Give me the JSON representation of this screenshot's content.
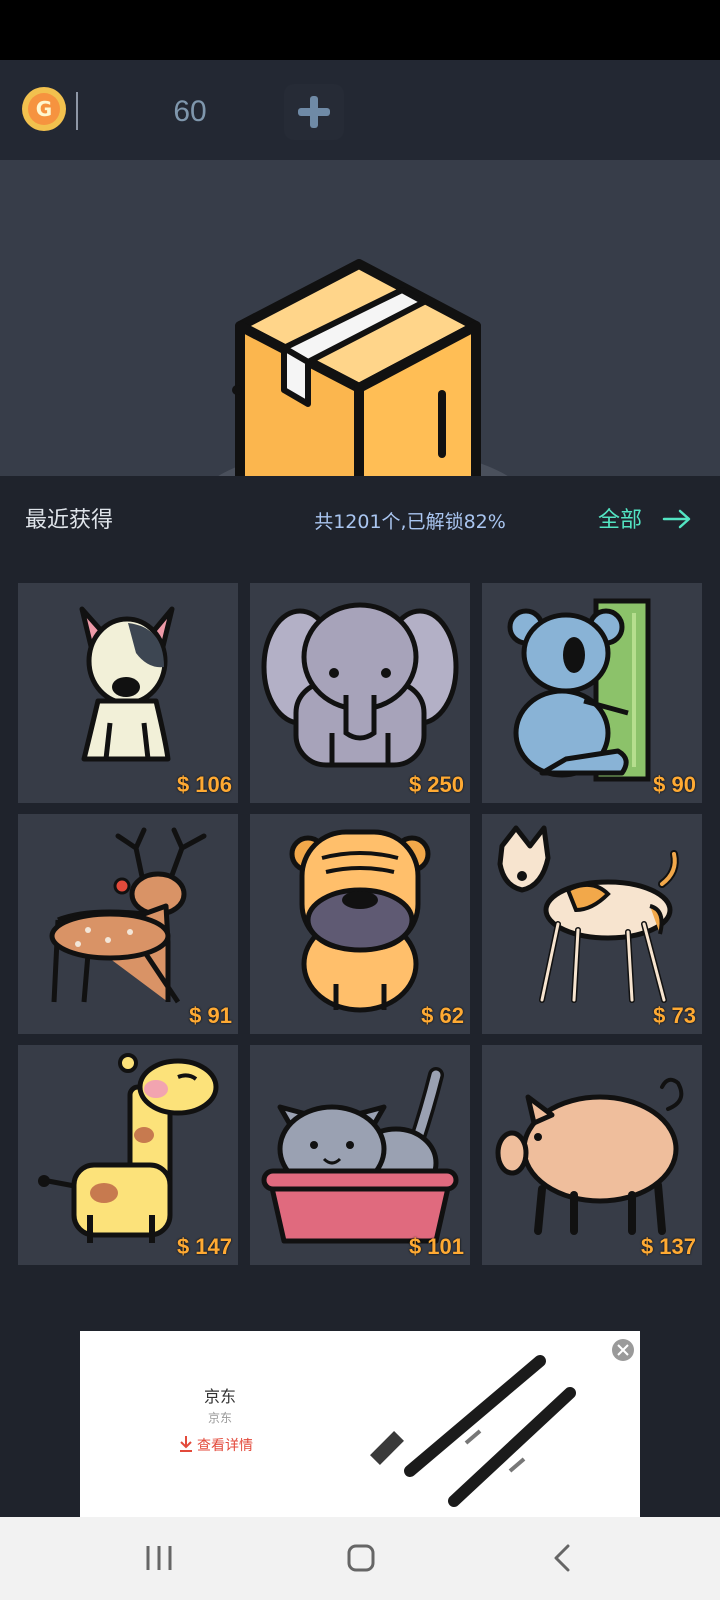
{
  "wallet": {
    "coin_icon": "gold-coin-g-icon",
    "coin_letter": "G",
    "balance": "60",
    "add_icon": "plus-icon"
  },
  "hero": {
    "icon": "package-box-icon"
  },
  "collection": {
    "recent_label": "最近获得",
    "summary": "共1201个,已解锁82%",
    "all_label": "全部",
    "all_icon": "arrow-right-icon",
    "items": [
      {
        "animal": "dog",
        "price": "$ 106"
      },
      {
        "animal": "elephant",
        "price": "$ 250"
      },
      {
        "animal": "koala",
        "price": "$ 90"
      },
      {
        "animal": "deer",
        "price": "$ 91"
      },
      {
        "animal": "shar-pei",
        "price": "$ 62"
      },
      {
        "animal": "hound",
        "price": "$ 73"
      },
      {
        "animal": "giraffe",
        "price": "$ 147"
      },
      {
        "animal": "cat",
        "price": "$ 101"
      },
      {
        "animal": "pig",
        "price": "$ 137"
      }
    ]
  },
  "ad": {
    "brand": "京东",
    "sub": "京东",
    "detail": "查看详情",
    "close_icon": "close-icon"
  },
  "colors": {
    "background": "#1f232c",
    "card": "#373c47",
    "price": "#ffaa33",
    "summary": "#a9c5f0",
    "all_link": "#53e4c2"
  }
}
